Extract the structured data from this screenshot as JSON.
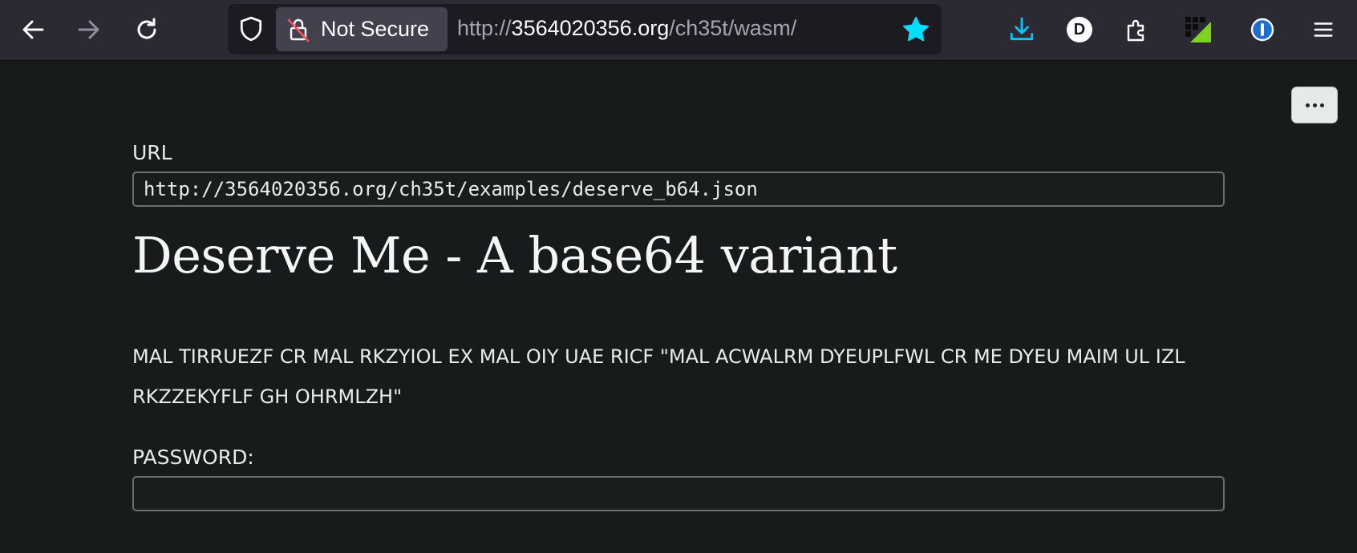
{
  "browser": {
    "security_label": "Not Secure",
    "url_scheme": "http://",
    "url_host": "3564020356.org",
    "url_path": "/ch35t/wasm/",
    "extensions": [
      {
        "name": "download-icon",
        "color": "#00c8ff"
      },
      {
        "name": "d-extension-icon",
        "letter": "D"
      },
      {
        "name": "extensions-puzzle-icon"
      },
      {
        "name": "grid-extension-icon"
      },
      {
        "name": "password-manager-icon"
      },
      {
        "name": "hamburger-menu-icon"
      }
    ],
    "star_color": "#00ddff"
  },
  "page": {
    "url_label": "URL",
    "url_value": "http://3564020356.org/ch35t/examples/deserve_b64.json",
    "title": "Deserve Me - A base64 variant",
    "cipher_text": "MAL TIRRUEZF CR MAL RKZYIOL EX MAL OIY UAE RICF \"MAL ACWALRM DYEUPLFWL CR ME DYEU MAIM UL IZL RKZZEKYFLF GH OHRMLZH\"",
    "password_label": "PASSWORD:",
    "password_value": ""
  }
}
